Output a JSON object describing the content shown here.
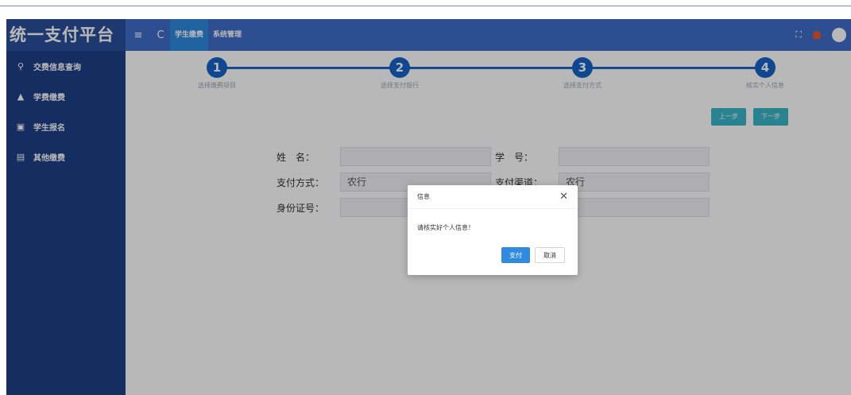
{
  "app": {
    "title": "统一支付平台",
    "accent_color": "#3f6cc8",
    "sidebar_color": "#1e3f86"
  },
  "sidebar": {
    "items": [
      {
        "icon": "search-icon",
        "label": "交费信息查询"
      },
      {
        "icon": "graduation-cap-icon",
        "label": "学费缴费"
      },
      {
        "icon": "id-card-icon",
        "label": "学生报名"
      },
      {
        "icon": "card-icon",
        "label": "其他缴费"
      }
    ]
  },
  "topbar": {
    "menu_icon": "≡",
    "refresh_icon": "C",
    "tabs": [
      {
        "label": "学生缴费",
        "active": true
      },
      {
        "label": "系统管理",
        "active": false
      }
    ],
    "fullscreen_icon": "⛶"
  },
  "steps": [
    {
      "number": "1",
      "label": "选择缴费项目"
    },
    {
      "number": "2",
      "label": "选择支付银行"
    },
    {
      "number": "3",
      "label": "选择支付方式"
    },
    {
      "number": "4",
      "label": "核实个人信息"
    }
  ],
  "nav": {
    "prev_label": "上一步",
    "next_label": "下一步"
  },
  "form": {
    "name_label": "姓　名：",
    "name_value": "",
    "student_id_label": "学　号：",
    "student_id_value": "",
    "pay_method_label": "支付方式：",
    "pay_method_value": "农行",
    "pay_channel_label": "支付渠道：",
    "pay_channel_value": "农行",
    "id_number_label": "身份证号：",
    "id_number_value": "",
    "extra_value": ""
  },
  "dialog": {
    "title": "信息",
    "message": "请核实好个人信息！",
    "ok_label": "支付",
    "cancel_label": "取消"
  }
}
